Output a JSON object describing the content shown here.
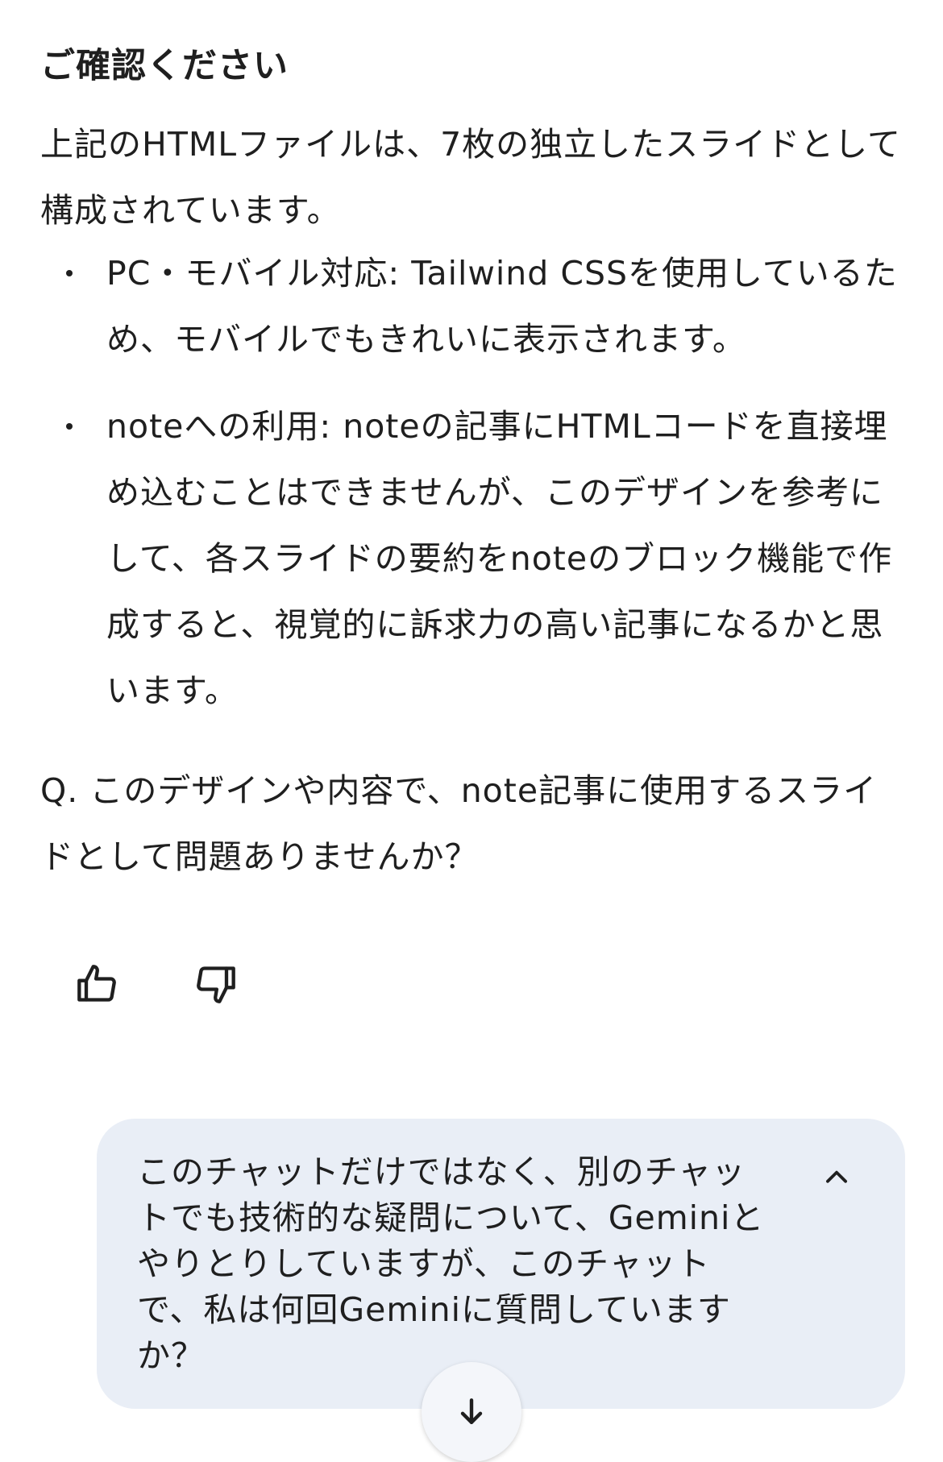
{
  "response": {
    "heading": "ご確認ください",
    "intro": "上記のHTMLファイルは、7枚の独立したスライドとして構成されています。",
    "bullets": [
      {
        "title": "PC・モバイル対応:",
        "text": " Tailwind CSSを使用しているため、モバイルでもきれいに表示されます。"
      },
      {
        "title": "noteへの利用:",
        "text": " noteの記事にHTMLコードを直接埋め込むことはできませんが、このデザインを参考にして、各スライドの要約をnoteのブロック機能で作成すると、視覚的に訴求力の高い記事になるかと思います。"
      }
    ],
    "question": "Q. このデザインや内容で、note記事に使用するスライドとして問題ありませんか？"
  },
  "feedback": {
    "like_icon": "thumb-up-icon",
    "dislike_icon": "thumb-down-icon"
  },
  "user_message": {
    "text": "このチャットだけではなく、別のチャットでも技術的な疑問について、Geminiとやりとりしていますが、このチャットで、私は何回Geminiに質問していますか？",
    "collapse_icon": "chevron-up-icon"
  },
  "scroll_button": {
    "icon": "arrow-down-icon"
  },
  "colors": {
    "text": "#1f1f1f",
    "bubble_bg": "#e9eef6",
    "page_bg": "#ffffff"
  }
}
